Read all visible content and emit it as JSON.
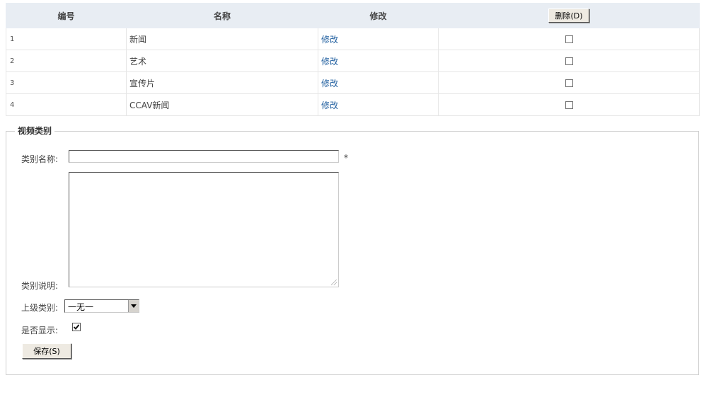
{
  "table": {
    "headers": {
      "id": "编号",
      "name": "名称",
      "edit": "修改",
      "delete_button": "删除(D)"
    },
    "rows": [
      {
        "id": "1",
        "name": "新闻",
        "edit_link": "修改",
        "checked": false
      },
      {
        "id": "2",
        "name": "艺术",
        "edit_link": "修改",
        "checked": false
      },
      {
        "id": "3",
        "name": "宣传片",
        "edit_link": "修改",
        "checked": false
      },
      {
        "id": "4",
        "name": "CCAV新闻",
        "edit_link": "修改",
        "checked": false
      }
    ]
  },
  "form": {
    "legend": "视频类别",
    "category_name_label": "类别名称:",
    "category_name_value": "",
    "required_marker": "*",
    "category_desc_label": "类别说明:",
    "category_desc_value": "",
    "parent_category_label": "上级类别:",
    "parent_category_value": "一无一",
    "is_visible_label": "是否显示:",
    "is_visible_checked": true,
    "save_button": "保存(S)"
  },
  "colors": {
    "header_bg": "#e8edf3",
    "link": "#1f5e9f",
    "border": "#e6e6e6",
    "button_bg": "#eeeae2"
  }
}
